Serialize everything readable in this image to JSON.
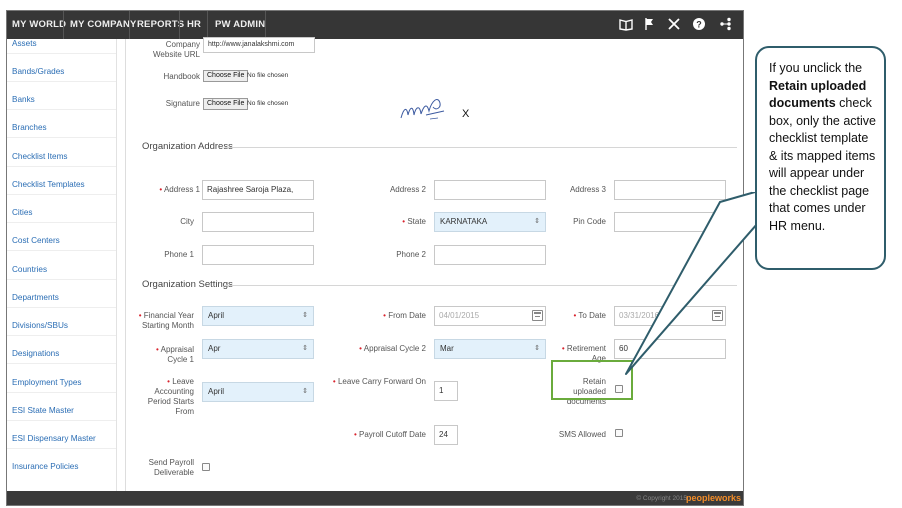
{
  "nav": {
    "items": [
      "MY WORLD",
      "MY COMPANY",
      "REPORTS",
      "HR",
      "PW ADMIN"
    ],
    "icons": [
      "book-icon",
      "flag-icon",
      "tools-icon",
      "help-icon",
      "share-icon"
    ]
  },
  "sidebar": {
    "items": [
      "Assets",
      "Bands/Grades",
      "Banks",
      "Branches",
      "Checklist Items",
      "Checklist Templates",
      "Cities",
      "Cost Centers",
      "Countries",
      "Departments",
      "Divisions/SBUs",
      "Designations",
      "Employment Types",
      "ESI State Master",
      "ESI Dispensary Master",
      "Insurance Policies"
    ]
  },
  "form": {
    "website_label": "Company Website URL",
    "website_value": "http://www.janalakshmi.com",
    "handbook_label": "Handbook",
    "signature_label": "Signature",
    "choose_file": "Choose File",
    "no_file": "No file chosen",
    "remove_mark": "X",
    "org_address_title": "Organization Address",
    "address1_label": "Address 1",
    "address1_value": "Rajashree Saroja Plaza,",
    "address2_label": "Address 2",
    "address3_label": "Address 3",
    "city_label": "City",
    "state_label": "State",
    "state_value": "KARNATAKA",
    "pincode_label": "Pin Code",
    "phone1_label": "Phone 1",
    "phone2_label": "Phone 2",
    "org_settings_title": "Organization Settings",
    "fy_label": "Financial Year Starting Month",
    "fy_value": "April",
    "from_date_label": "From Date",
    "from_date_value": "04/01/2015",
    "to_date_label": "To Date",
    "to_date_value": "03/31/2016",
    "appraisal1_label": "Appraisal Cycle 1",
    "appraisal1_value": "Apr",
    "appraisal2_label": "Appraisal Cycle 2",
    "appraisal2_value": "Mar",
    "retirement_label": "Retirement Age",
    "retirement_value": "60",
    "leave_period_label": "Leave Accounting Period Starts From",
    "leave_period_value": "April",
    "leave_carry_label": "Leave Carry Forward On",
    "leave_carry_value": "1",
    "retain_label": "Retain uploaded documents",
    "payroll_cutoff_label": "Payroll Cutoff Date",
    "payroll_cutoff_value": "24",
    "sms_label": "SMS Allowed",
    "send_payroll_label": "Send Payroll Deliverable",
    "required_mark": "•"
  },
  "footer": {
    "copyright": "© Copyright 2015",
    "logo": "peopleworks"
  },
  "callout": {
    "pre": "If you unclick the ",
    "bold": "Retain uploaded documents",
    "post": " check box, only the active checklist template & its mapped items will appear under the checklist page that comes under HR menu."
  }
}
